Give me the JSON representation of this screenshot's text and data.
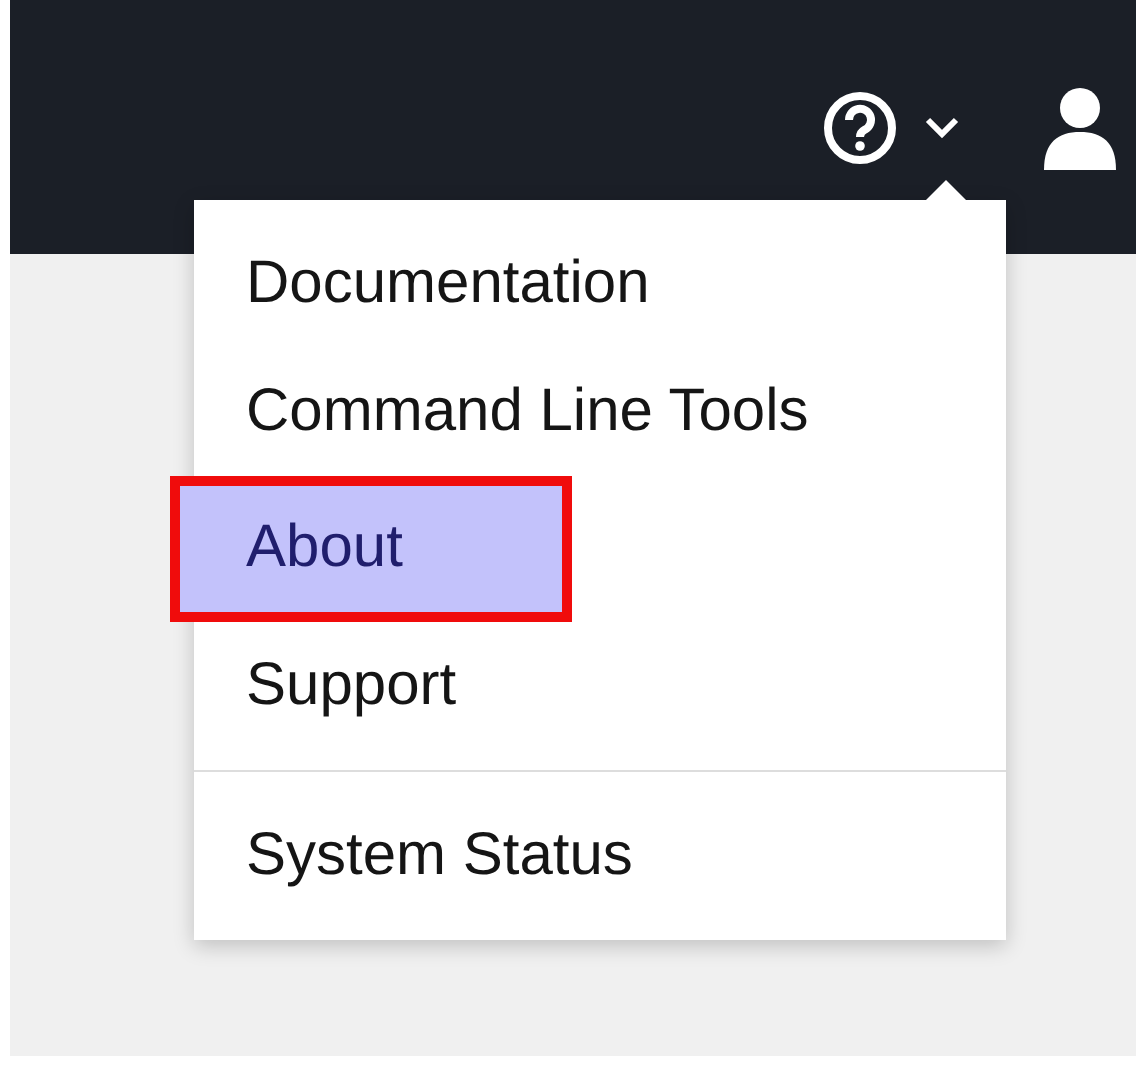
{
  "menu": {
    "groups": [
      [
        {
          "label": "Documentation",
          "selected": false
        },
        {
          "label": "Command Line Tools",
          "selected": false
        },
        {
          "label": "About",
          "selected": true
        },
        {
          "label": "Support",
          "selected": false
        }
      ],
      [
        {
          "label": "System Status",
          "selected": false
        }
      ]
    ]
  }
}
